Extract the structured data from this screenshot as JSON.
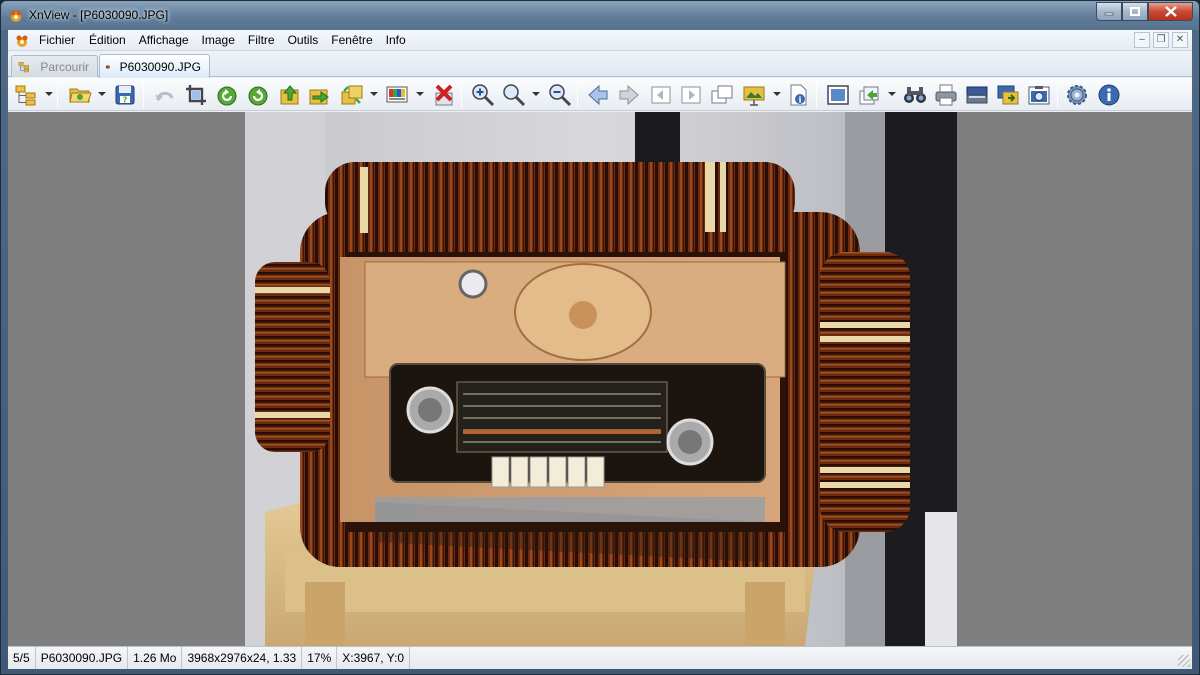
{
  "window": {
    "title": "XnView - [P6030090.JPG]"
  },
  "menu": {
    "items": [
      "Fichier",
      "Édition",
      "Affichage",
      "Image",
      "Filtre",
      "Outils",
      "Fenêtre",
      "Info"
    ]
  },
  "tabs": [
    {
      "label": "Parcourir",
      "active": false
    },
    {
      "label": "P6030090.JPG",
      "active": true
    }
  ],
  "toolbar": {
    "buttons": [
      "browser-tree-icon",
      "open-folder-icon",
      "save-icon",
      "undo-icon",
      "crop-icon",
      "rotate-left-icon",
      "rotate-right-icon",
      "move-icon",
      "copy-to-icon",
      "convert-icon",
      "adjust-colors-icon",
      "delete-icon",
      "zoom-in-icon",
      "zoom-icon",
      "zoom-out-icon",
      "previous-icon",
      "next-icon",
      "first-icon",
      "last-icon",
      "window-icon",
      "slideshow-icon",
      "properties-icon",
      "fullscreen-icon",
      "export-icon",
      "binoculars-icon",
      "print-icon",
      "scanner-icon",
      "capture-icon",
      "camera-icon",
      "settings-icon",
      "info-icon"
    ]
  },
  "status": {
    "index": "5/5",
    "filename": "P6030090.JPG",
    "size": "1.26 Mo",
    "dimensions": "3968x2976x24, 1.33",
    "zoom": "17%",
    "coords": "X:3967, Y:0"
  },
  "colors": {
    "viewer_background": "#7f7f7f",
    "title_gradient": "#6f8aa6",
    "close_button": "#c84a32"
  }
}
